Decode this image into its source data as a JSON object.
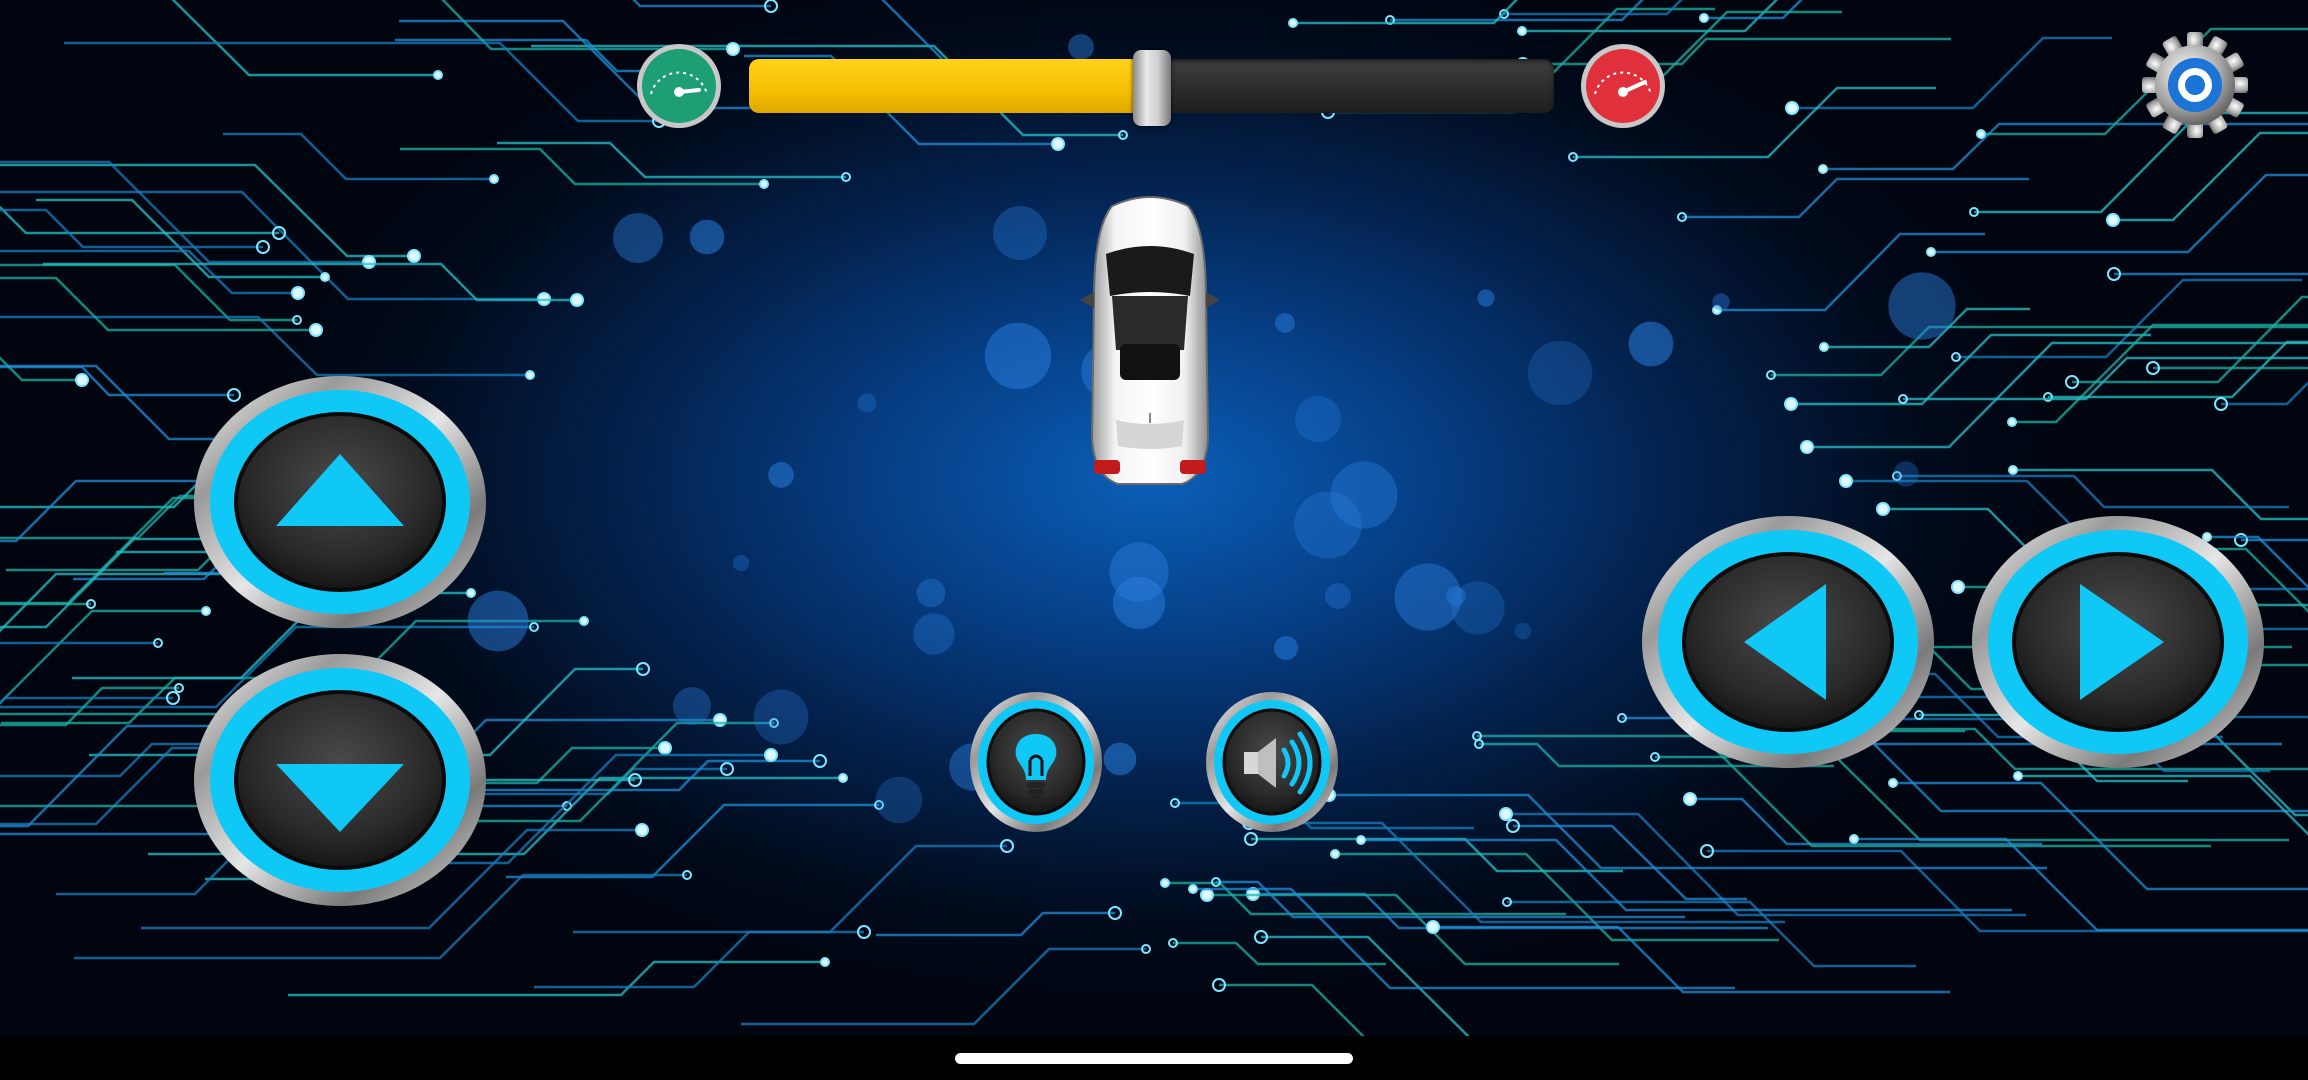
{
  "speed_control": {
    "level": 0.5,
    "slow_icon": "speedometer-slow-icon",
    "fast_icon": "speedometer-fast-icon",
    "colors": {
      "fill": "#f5bf00",
      "track": "#2e2e2e",
      "slow": "#1e9e74",
      "fast": "#e0303c"
    }
  },
  "settings": {
    "icon": "gear-icon"
  },
  "car": {
    "icon": "car-top-view-icon",
    "color": "#e6e6e6"
  },
  "controls": {
    "forward": {
      "icon": "arrow-up-icon"
    },
    "backward": {
      "icon": "arrow-down-icon"
    },
    "left": {
      "icon": "arrow-left-icon"
    },
    "right": {
      "icon": "arrow-right-icon"
    },
    "light": {
      "icon": "light-bulb-icon"
    },
    "horn": {
      "icon": "speaker-icon"
    },
    "accent": "#10c8f5"
  },
  "background": {
    "theme": "circuit-board",
    "glow": "#0a5fb8"
  }
}
